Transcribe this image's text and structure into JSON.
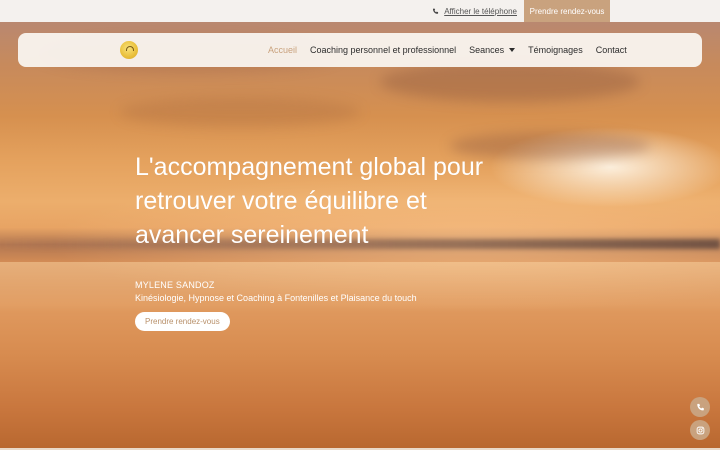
{
  "topbar": {
    "phone_link": "Afficher le téléphone",
    "phone_icon": "phone-icon",
    "cta": "Prendre rendez-vous"
  },
  "nav": {
    "logo_icon": "logo-icon",
    "items": [
      {
        "label": "Accueil",
        "active": true
      },
      {
        "label": "Coaching personnel et professionnel",
        "active": false
      },
      {
        "label": "Seances",
        "active": false,
        "dropdown": true
      },
      {
        "label": "Témoignages",
        "active": false
      },
      {
        "label": "Contact",
        "active": false
      }
    ]
  },
  "hero": {
    "title": "L'accompagnement global pour retrouver votre équilibre et avancer sereinement",
    "name": "MYLENE SANDOZ",
    "subtitle": "Kinésiologie, Hypnose et Coaching à Fontenilles et Plaisance du touch",
    "button": "Prendre rendez-vous"
  },
  "floating": {
    "phone_icon": "phone-icon",
    "instagram_icon": "instagram-icon"
  },
  "colors": {
    "accent": "#c9a27e",
    "text_dark": "#2d2d2d",
    "topbar_bg": "#f4f1ee"
  }
}
